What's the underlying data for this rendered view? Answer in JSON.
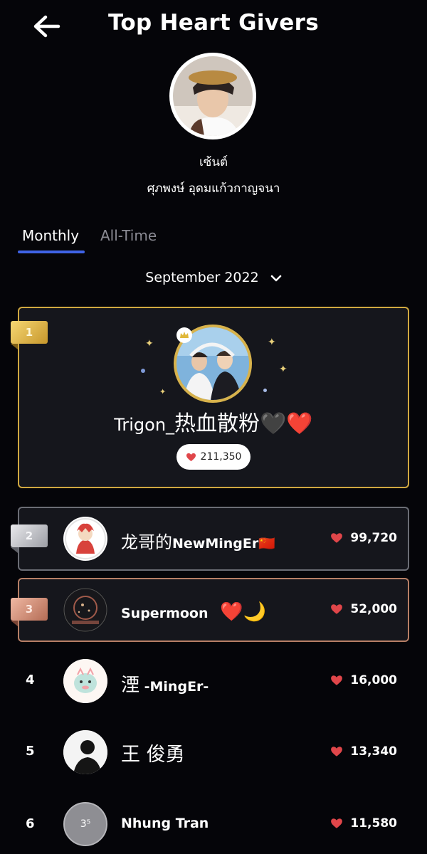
{
  "header": {
    "title": "Top Heart Givers",
    "back_icon": "arrow-left-icon"
  },
  "profile": {
    "nickname": "เซ้นต์",
    "full_name": "ศุภพงษ์ อุดมแก้วกาญจนา"
  },
  "tabs": [
    {
      "label": "Monthly",
      "active": true
    },
    {
      "label": "All-Time",
      "active": false
    }
  ],
  "period": {
    "label": "September 2022",
    "icon": "chevron-down-icon"
  },
  "colors": {
    "accent": "#3f63e6",
    "heart": "#e0464a",
    "gold": "#d0a840",
    "silver": "#a7a9b0",
    "bronze": "#b77f66"
  },
  "leaderboard": [
    {
      "rank": "1",
      "name_prefix": "Trigon_",
      "name_main": "热血散粉",
      "name_emoji": "🖤❤️",
      "score": "211,350"
    },
    {
      "rank": "2",
      "name_main": "龙哥的",
      "name_suffix": "NewMingEr",
      "name_emoji": "🇨🇳",
      "score": "99,720"
    },
    {
      "rank": "3",
      "name_main": "Supermoon",
      "name_emoji": "❤️🌙",
      "score": "52,000"
    },
    {
      "rank": "4",
      "name_main": "湮",
      "name_suffix": " -MingEr-",
      "score": "16,000"
    },
    {
      "rank": "5",
      "name_main": "王 俊勇",
      "score": "13,340"
    },
    {
      "rank": "6",
      "name_main": "Nhung Tran",
      "avatar_text": "3⁵",
      "score": "11,580"
    }
  ]
}
